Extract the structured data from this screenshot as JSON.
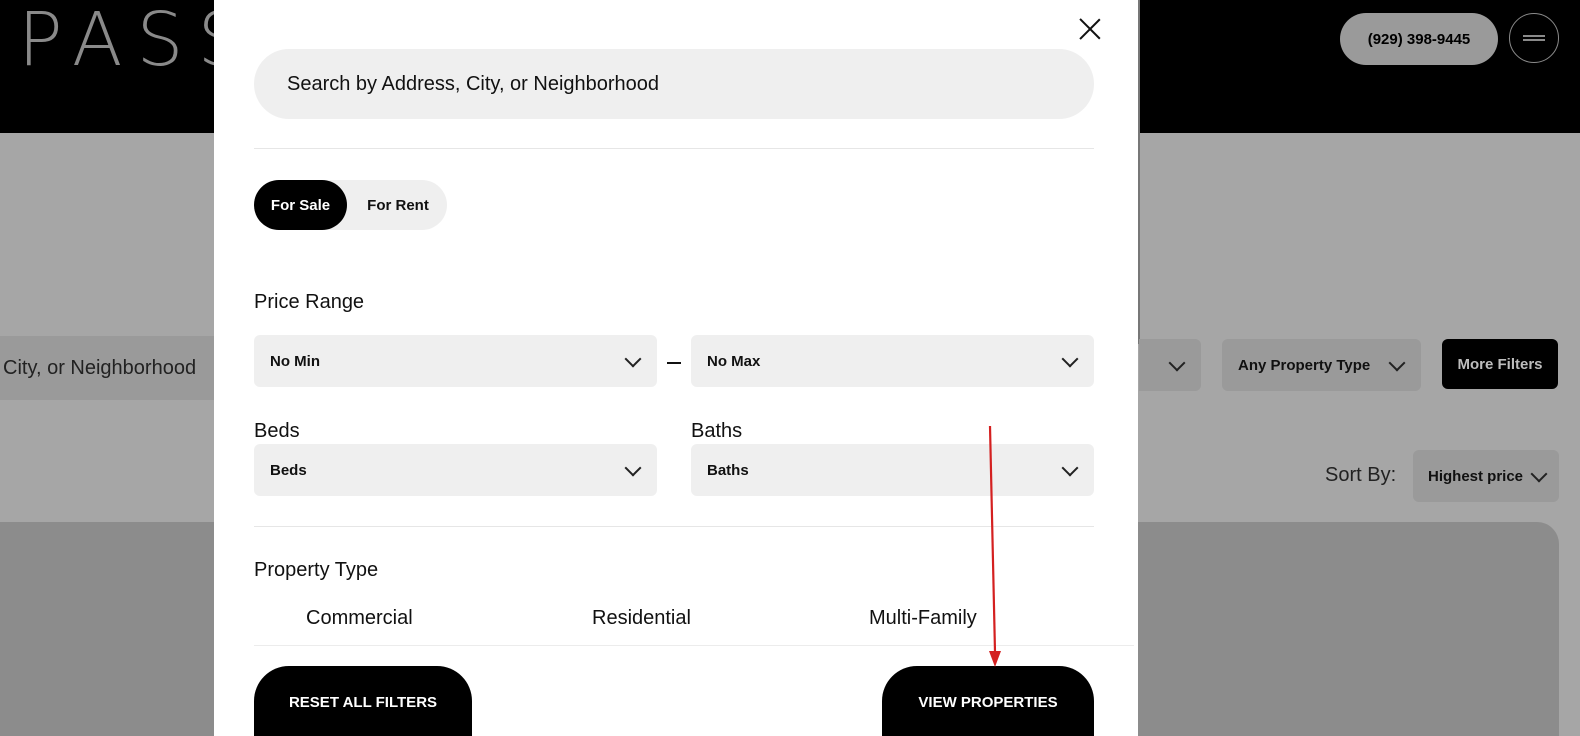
{
  "header": {
    "logo_text": "PASS",
    "phone": "(929) 398-9445",
    "menu_icon": "hamburger-icon"
  },
  "background": {
    "search_fragment": "City, or Neighborhood",
    "property_type_select": "Any Property Type",
    "more_filters_label": "More Filters",
    "sort_label": "Sort By:",
    "sort_value": "Highest price"
  },
  "modal": {
    "close_icon": "close-icon",
    "search_placeholder": "Search by Address, City, or Neighborhood",
    "listing_toggle": {
      "active": "For Sale",
      "inactive": "For Rent"
    },
    "price_range": {
      "label": "Price Range",
      "min": "No Min",
      "max": "No Max"
    },
    "beds": {
      "label": "Beds",
      "value": "Beds"
    },
    "baths": {
      "label": "Baths",
      "value": "Baths"
    },
    "property_type": {
      "label": "Property Type",
      "options": [
        "Commercial",
        "Residential",
        "Multi-Family"
      ]
    },
    "reset_label": "RESET ALL FILTERS",
    "view_label": "VIEW PROPERTIES"
  },
  "colors": {
    "accent": "#000000",
    "annotation_arrow": "#d42020",
    "field_background": "#efefef"
  }
}
